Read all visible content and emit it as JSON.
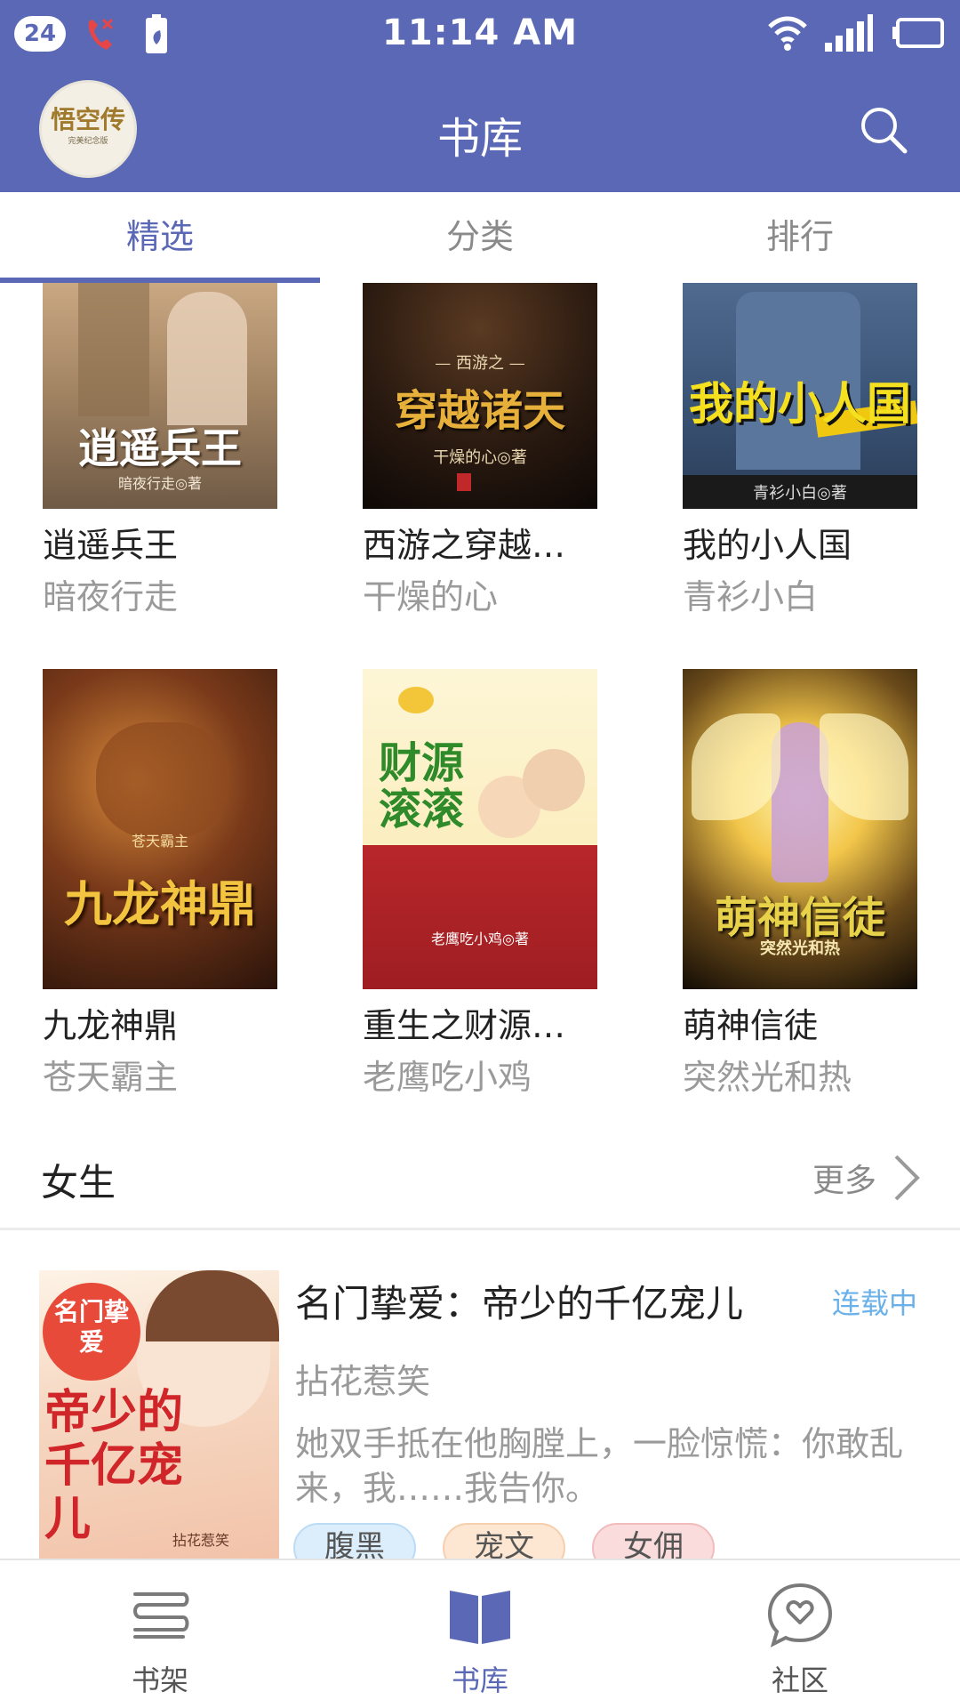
{
  "status_bar": {
    "notification_count": "24",
    "time": "11:14 AM",
    "icons": [
      "missed-call-icon",
      "battery-saver-icon",
      "wifi-icon",
      "signal-icon",
      "battery-icon"
    ]
  },
  "header": {
    "title": "书库",
    "avatar_text": "悟空传",
    "avatar_subtext": "完美纪念版",
    "search_icon": "search-icon"
  },
  "tabs": [
    {
      "label": "精选",
      "active": true
    },
    {
      "label": "分类",
      "active": false
    },
    {
      "label": "排行",
      "active": false
    }
  ],
  "books": [
    {
      "title": "逍遥兵王",
      "author": "暗夜行走",
      "cover_text": "逍遥兵王",
      "cover_subtext": "暗夜行走◎著"
    },
    {
      "title": "西游之穿越…",
      "author": "干燥的心",
      "cover_text": "穿越诸天",
      "cover_subtext": "干燥的心◎著"
    },
    {
      "title": "我的小人国",
      "author": "青衫小白",
      "cover_text": "我的小人国",
      "cover_subtext": "青衫小白◎著"
    },
    {
      "title": "九龙神鼎",
      "author": "苍天霸主",
      "cover_text": "九龙神鼎",
      "cover_subtext": "苍天霸主"
    },
    {
      "title": "重生之财源…",
      "author": "老鹰吃小鸡",
      "cover_text": "财源滚滚",
      "cover_subtext": "老鹰吃小鸡◎著"
    },
    {
      "title": "萌神信徒",
      "author": "突然光和热",
      "cover_text": "萌神信徒",
      "cover_subtext": "突然光和热"
    }
  ],
  "section": {
    "title": "女生",
    "more_label": "更多"
  },
  "featured": {
    "title": "名门挚爱：帝少的千亿宠儿",
    "status": "连载中",
    "author": "拈花惹笑",
    "description": "她双手抵在他胸膛上，一脸惊慌：你敢乱来，我……我告你。",
    "cover_text_top": "名门挚爱",
    "cover_text_main": "帝少的千亿宠儿",
    "cover_author": "拈花惹笑",
    "tags": [
      "腹黑",
      "宠文",
      "女佣"
    ]
  },
  "bottom_nav": [
    {
      "label": "书架",
      "icon": "bookshelf-icon",
      "active": false
    },
    {
      "label": "书库",
      "icon": "book-open-icon",
      "active": true
    },
    {
      "label": "社区",
      "icon": "community-chat-icon",
      "active": false
    }
  ],
  "colors": {
    "primary": "#5a68b5",
    "status_serial": "#6ab1ea",
    "tag_blue": "#dceefc",
    "tag_orange": "#fde6d2",
    "tag_pink": "#fbdcdc"
  }
}
